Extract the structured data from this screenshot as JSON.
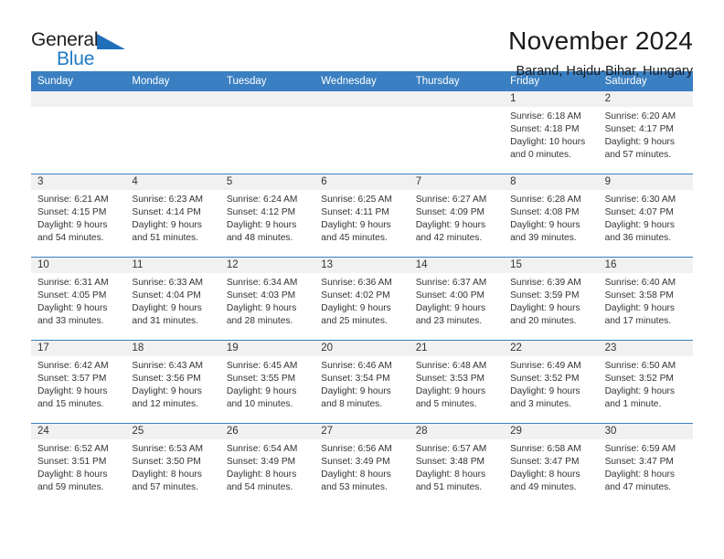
{
  "logo": {
    "word_one": "General",
    "word_two": "Blue",
    "icon": "triangle-mark"
  },
  "header": {
    "title": "November 2024",
    "subtitle": "Barand, Hajdu-Bihar, Hungary"
  },
  "colors": {
    "header_blue": "#3a7fc1",
    "daynum_bg": "#f1f1f1",
    "logo_blue": "#1f7ac4",
    "text": "#333333"
  },
  "calendar": {
    "weekdays": [
      "Sunday",
      "Monday",
      "Tuesday",
      "Wednesday",
      "Thursday",
      "Friday",
      "Saturday"
    ],
    "labels": {
      "sunrise": "Sunrise:",
      "sunset": "Sunset:",
      "daylight": "Daylight:"
    },
    "weeks": [
      [
        {
          "day": "",
          "sunrise": "",
          "sunset": "",
          "daylight": ""
        },
        {
          "day": "",
          "sunrise": "",
          "sunset": "",
          "daylight": ""
        },
        {
          "day": "",
          "sunrise": "",
          "sunset": "",
          "daylight": ""
        },
        {
          "day": "",
          "sunrise": "",
          "sunset": "",
          "daylight": ""
        },
        {
          "day": "",
          "sunrise": "",
          "sunset": "",
          "daylight": ""
        },
        {
          "day": "1",
          "sunrise": "Sunrise: 6:18 AM",
          "sunset": "Sunset: 4:18 PM",
          "daylight": "Daylight: 10 hours and 0 minutes."
        },
        {
          "day": "2",
          "sunrise": "Sunrise: 6:20 AM",
          "sunset": "Sunset: 4:17 PM",
          "daylight": "Daylight: 9 hours and 57 minutes."
        }
      ],
      [
        {
          "day": "3",
          "sunrise": "Sunrise: 6:21 AM",
          "sunset": "Sunset: 4:15 PM",
          "daylight": "Daylight: 9 hours and 54 minutes."
        },
        {
          "day": "4",
          "sunrise": "Sunrise: 6:23 AM",
          "sunset": "Sunset: 4:14 PM",
          "daylight": "Daylight: 9 hours and 51 minutes."
        },
        {
          "day": "5",
          "sunrise": "Sunrise: 6:24 AM",
          "sunset": "Sunset: 4:12 PM",
          "daylight": "Daylight: 9 hours and 48 minutes."
        },
        {
          "day": "6",
          "sunrise": "Sunrise: 6:25 AM",
          "sunset": "Sunset: 4:11 PM",
          "daylight": "Daylight: 9 hours and 45 minutes."
        },
        {
          "day": "7",
          "sunrise": "Sunrise: 6:27 AM",
          "sunset": "Sunset: 4:09 PM",
          "daylight": "Daylight: 9 hours and 42 minutes."
        },
        {
          "day": "8",
          "sunrise": "Sunrise: 6:28 AM",
          "sunset": "Sunset: 4:08 PM",
          "daylight": "Daylight: 9 hours and 39 minutes."
        },
        {
          "day": "9",
          "sunrise": "Sunrise: 6:30 AM",
          "sunset": "Sunset: 4:07 PM",
          "daylight": "Daylight: 9 hours and 36 minutes."
        }
      ],
      [
        {
          "day": "10",
          "sunrise": "Sunrise: 6:31 AM",
          "sunset": "Sunset: 4:05 PM",
          "daylight": "Daylight: 9 hours and 33 minutes."
        },
        {
          "day": "11",
          "sunrise": "Sunrise: 6:33 AM",
          "sunset": "Sunset: 4:04 PM",
          "daylight": "Daylight: 9 hours and 31 minutes."
        },
        {
          "day": "12",
          "sunrise": "Sunrise: 6:34 AM",
          "sunset": "Sunset: 4:03 PM",
          "daylight": "Daylight: 9 hours and 28 minutes."
        },
        {
          "day": "13",
          "sunrise": "Sunrise: 6:36 AM",
          "sunset": "Sunset: 4:02 PM",
          "daylight": "Daylight: 9 hours and 25 minutes."
        },
        {
          "day": "14",
          "sunrise": "Sunrise: 6:37 AM",
          "sunset": "Sunset: 4:00 PM",
          "daylight": "Daylight: 9 hours and 23 minutes."
        },
        {
          "day": "15",
          "sunrise": "Sunrise: 6:39 AM",
          "sunset": "Sunset: 3:59 PM",
          "daylight": "Daylight: 9 hours and 20 minutes."
        },
        {
          "day": "16",
          "sunrise": "Sunrise: 6:40 AM",
          "sunset": "Sunset: 3:58 PM",
          "daylight": "Daylight: 9 hours and 17 minutes."
        }
      ],
      [
        {
          "day": "17",
          "sunrise": "Sunrise: 6:42 AM",
          "sunset": "Sunset: 3:57 PM",
          "daylight": "Daylight: 9 hours and 15 minutes."
        },
        {
          "day": "18",
          "sunrise": "Sunrise: 6:43 AM",
          "sunset": "Sunset: 3:56 PM",
          "daylight": "Daylight: 9 hours and 12 minutes."
        },
        {
          "day": "19",
          "sunrise": "Sunrise: 6:45 AM",
          "sunset": "Sunset: 3:55 PM",
          "daylight": "Daylight: 9 hours and 10 minutes."
        },
        {
          "day": "20",
          "sunrise": "Sunrise: 6:46 AM",
          "sunset": "Sunset: 3:54 PM",
          "daylight": "Daylight: 9 hours and 8 minutes."
        },
        {
          "day": "21",
          "sunrise": "Sunrise: 6:48 AM",
          "sunset": "Sunset: 3:53 PM",
          "daylight": "Daylight: 9 hours and 5 minutes."
        },
        {
          "day": "22",
          "sunrise": "Sunrise: 6:49 AM",
          "sunset": "Sunset: 3:52 PM",
          "daylight": "Daylight: 9 hours and 3 minutes."
        },
        {
          "day": "23",
          "sunrise": "Sunrise: 6:50 AM",
          "sunset": "Sunset: 3:52 PM",
          "daylight": "Daylight: 9 hours and 1 minute."
        }
      ],
      [
        {
          "day": "24",
          "sunrise": "Sunrise: 6:52 AM",
          "sunset": "Sunset: 3:51 PM",
          "daylight": "Daylight: 8 hours and 59 minutes."
        },
        {
          "day": "25",
          "sunrise": "Sunrise: 6:53 AM",
          "sunset": "Sunset: 3:50 PM",
          "daylight": "Daylight: 8 hours and 57 minutes."
        },
        {
          "day": "26",
          "sunrise": "Sunrise: 6:54 AM",
          "sunset": "Sunset: 3:49 PM",
          "daylight": "Daylight: 8 hours and 54 minutes."
        },
        {
          "day": "27",
          "sunrise": "Sunrise: 6:56 AM",
          "sunset": "Sunset: 3:49 PM",
          "daylight": "Daylight: 8 hours and 53 minutes."
        },
        {
          "day": "28",
          "sunrise": "Sunrise: 6:57 AM",
          "sunset": "Sunset: 3:48 PM",
          "daylight": "Daylight: 8 hours and 51 minutes."
        },
        {
          "day": "29",
          "sunrise": "Sunrise: 6:58 AM",
          "sunset": "Sunset: 3:47 PM",
          "daylight": "Daylight: 8 hours and 49 minutes."
        },
        {
          "day": "30",
          "sunrise": "Sunrise: 6:59 AM",
          "sunset": "Sunset: 3:47 PM",
          "daylight": "Daylight: 8 hours and 47 minutes."
        }
      ]
    ]
  }
}
